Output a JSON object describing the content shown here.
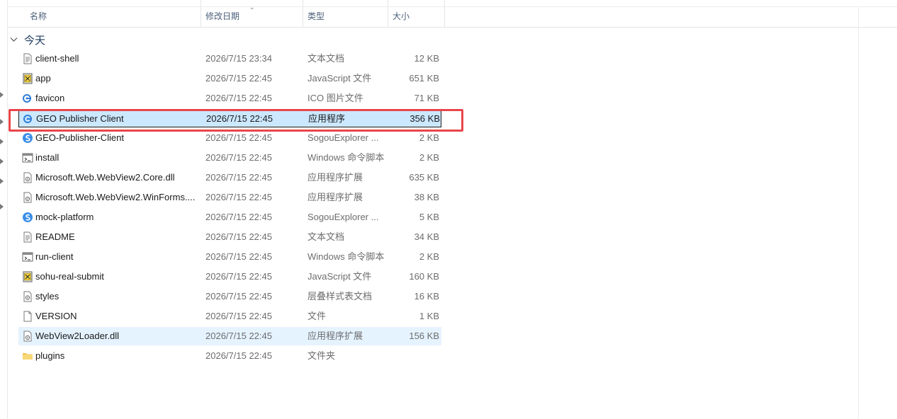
{
  "header": {
    "columns": [
      "名称",
      "修改日期",
      "类型",
      "大小"
    ]
  },
  "group": {
    "label": "今天"
  },
  "files": [
    {
      "name": "client-shell",
      "date": "2026/7/15 23:34",
      "type": "文本文档",
      "size": "12 KB",
      "icon": "text-file-icon"
    },
    {
      "name": "app",
      "date": "2026/7/15 22:45",
      "type": "JavaScript 文件",
      "size": "651 KB",
      "icon": "javascript-file-icon"
    },
    {
      "name": "favicon",
      "date": "2026/7/15 22:45",
      "type": "ICO 图片文件",
      "size": "71 KB",
      "icon": "ico-file-icon"
    },
    {
      "name": "GEO Publisher Client",
      "date": "2026/7/15 22:45",
      "type": "应用程序",
      "size": "356 KB",
      "icon": "application-icon"
    },
    {
      "name": "GEO-Publisher-Client",
      "date": "2026/7/15 22:45",
      "type": "SogouExplorer ...",
      "size": "2 KB",
      "icon": "sogou-explorer-icon"
    },
    {
      "name": "install",
      "date": "2026/7/15 22:45",
      "type": "Windows 命令脚本",
      "size": "2 KB",
      "icon": "cmd-script-icon"
    },
    {
      "name": "Microsoft.Web.WebView2.Core.dll",
      "date": "2026/7/15 22:45",
      "type": "应用程序扩展",
      "size": "635 KB",
      "icon": "dll-file-icon"
    },
    {
      "name": "Microsoft.Web.WebView2.WinForms....",
      "date": "2026/7/15 22:45",
      "type": "应用程序扩展",
      "size": "38 KB",
      "icon": "dll-file-icon"
    },
    {
      "name": "mock-platform",
      "date": "2026/7/15 22:45",
      "type": "SogouExplorer ...",
      "size": "5 KB",
      "icon": "sogou-explorer-icon"
    },
    {
      "name": "README",
      "date": "2026/7/15 22:45",
      "type": "文本文档",
      "size": "34 KB",
      "icon": "text-file-icon"
    },
    {
      "name": "run-client",
      "date": "2026/7/15 22:45",
      "type": "Windows 命令脚本",
      "size": "2 KB",
      "icon": "cmd-script-icon"
    },
    {
      "name": "sohu-real-submit",
      "date": "2026/7/15 22:45",
      "type": "JavaScript 文件",
      "size": "160 KB",
      "icon": "javascript-file-icon"
    },
    {
      "name": "styles",
      "date": "2026/7/15 22:45",
      "type": "层叠样式表文档",
      "size": "16 KB",
      "icon": "css-file-icon"
    },
    {
      "name": "VERSION",
      "date": "2026/7/15 22:45",
      "type": "文件",
      "size": "1 KB",
      "icon": "blank-file-icon"
    },
    {
      "name": "WebView2Loader.dll",
      "date": "2026/7/15 22:45",
      "type": "应用程序扩展",
      "size": "156 KB",
      "icon": "dll-file-icon"
    },
    {
      "name": "plugins",
      "date": "2026/7/15 22:45",
      "type": "文件夹",
      "size": "",
      "icon": "folder-icon"
    }
  ],
  "selected_index": 3,
  "hover_index": 14,
  "colors": {
    "selection": "#cce8ff",
    "hover": "#e5f3ff",
    "highlight_box": "#e8464a"
  }
}
